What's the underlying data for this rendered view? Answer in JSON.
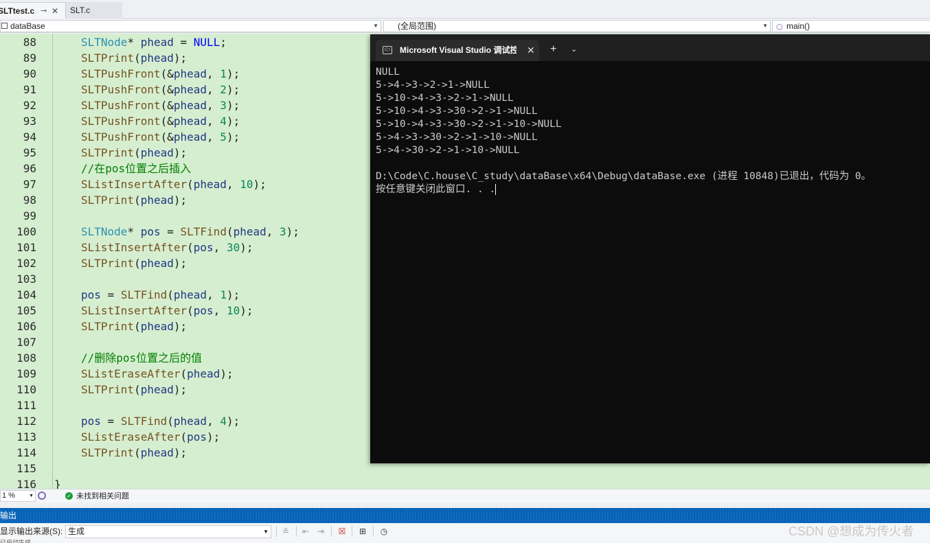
{
  "tabs": [
    {
      "label": "SLTtest.c",
      "pin": "⊸",
      "close": "✕"
    },
    {
      "label": "SLT.c"
    }
  ],
  "navbar": {
    "project": "dataBase",
    "scope": "(全局范围)",
    "member": "main()"
  },
  "editor": {
    "lines": [
      {
        "n": "88",
        "tokens": [
          [
            "t-type",
            "SLTNode"
          ],
          [
            "",
            "* "
          ],
          [
            "t-var",
            "phead"
          ],
          [
            "",
            " = "
          ],
          [
            "t-kw",
            "NULL"
          ],
          [
            "",
            ";"
          ]
        ]
      },
      {
        "n": "89",
        "tokens": [
          [
            "t-fn",
            "SLTPrint"
          ],
          [
            "",
            "("
          ],
          [
            "t-var",
            "phead"
          ],
          [
            "",
            ");"
          ]
        ]
      },
      {
        "n": "90",
        "tokens": [
          [
            "t-fn",
            "SLTPushFront"
          ],
          [
            "",
            "(&"
          ],
          [
            "t-var",
            "phead"
          ],
          [
            "",
            ", "
          ],
          [
            "t-num",
            "1"
          ],
          [
            "",
            ");"
          ]
        ]
      },
      {
        "n": "91",
        "tokens": [
          [
            "t-fn",
            "SLTPushFront"
          ],
          [
            "",
            "(&"
          ],
          [
            "t-var",
            "phead"
          ],
          [
            "",
            ", "
          ],
          [
            "t-num",
            "2"
          ],
          [
            "",
            ");"
          ]
        ]
      },
      {
        "n": "92",
        "tokens": [
          [
            "t-fn",
            "SLTPushFront"
          ],
          [
            "",
            "(&"
          ],
          [
            "t-var",
            "phead"
          ],
          [
            "",
            ", "
          ],
          [
            "t-num",
            "3"
          ],
          [
            "",
            ");"
          ]
        ]
      },
      {
        "n": "93",
        "tokens": [
          [
            "t-fn",
            "SLTPushFront"
          ],
          [
            "",
            "(&"
          ],
          [
            "t-var",
            "phead"
          ],
          [
            "",
            ", "
          ],
          [
            "t-num",
            "4"
          ],
          [
            "",
            ");"
          ]
        ]
      },
      {
        "n": "94",
        "tokens": [
          [
            "t-fn",
            "SLTPushFront"
          ],
          [
            "",
            "(&"
          ],
          [
            "t-var",
            "phead"
          ],
          [
            "",
            ", "
          ],
          [
            "t-num",
            "5"
          ],
          [
            "",
            ");"
          ]
        ]
      },
      {
        "n": "95",
        "tokens": [
          [
            "t-fn",
            "SLTPrint"
          ],
          [
            "",
            "("
          ],
          [
            "t-var",
            "phead"
          ],
          [
            "",
            ");"
          ]
        ]
      },
      {
        "n": "96",
        "tokens": [
          [
            "t-cm",
            "//在pos位置之后插入"
          ]
        ]
      },
      {
        "n": "97",
        "tokens": [
          [
            "t-fn",
            "SListInsertAfter"
          ],
          [
            "",
            "("
          ],
          [
            "t-var",
            "phead"
          ],
          [
            "",
            ", "
          ],
          [
            "t-num",
            "10"
          ],
          [
            "",
            ");"
          ]
        ]
      },
      {
        "n": "98",
        "tokens": [
          [
            "t-fn",
            "SLTPrint"
          ],
          [
            "",
            "("
          ],
          [
            "t-var",
            "phead"
          ],
          [
            "",
            ");"
          ]
        ]
      },
      {
        "n": "99",
        "tokens": []
      },
      {
        "n": "100",
        "tokens": [
          [
            "t-type",
            "SLTNode"
          ],
          [
            "",
            "* "
          ],
          [
            "t-var",
            "pos"
          ],
          [
            "",
            " = "
          ],
          [
            "t-fn",
            "SLTFind"
          ],
          [
            "",
            "("
          ],
          [
            "t-var",
            "phead"
          ],
          [
            "",
            ", "
          ],
          [
            "t-num",
            "3"
          ],
          [
            "",
            ");"
          ]
        ]
      },
      {
        "n": "101",
        "tokens": [
          [
            "t-fn",
            "SListInsertAfter"
          ],
          [
            "",
            "("
          ],
          [
            "t-var",
            "pos"
          ],
          [
            "",
            ", "
          ],
          [
            "t-num",
            "30"
          ],
          [
            "",
            ");"
          ]
        ]
      },
      {
        "n": "102",
        "tokens": [
          [
            "t-fn",
            "SLTPrint"
          ],
          [
            "",
            "("
          ],
          [
            "t-var",
            "phead"
          ],
          [
            "",
            ");"
          ]
        ]
      },
      {
        "n": "103",
        "tokens": []
      },
      {
        "n": "104",
        "tokens": [
          [
            "t-var",
            "pos"
          ],
          [
            "",
            " = "
          ],
          [
            "t-fn",
            "SLTFind"
          ],
          [
            "",
            "("
          ],
          [
            "t-var",
            "phead"
          ],
          [
            "",
            ", "
          ],
          [
            "t-num",
            "1"
          ],
          [
            "",
            ");"
          ]
        ]
      },
      {
        "n": "105",
        "tokens": [
          [
            "t-fn",
            "SListInsertAfter"
          ],
          [
            "",
            "("
          ],
          [
            "t-var",
            "pos"
          ],
          [
            "",
            ", "
          ],
          [
            "t-num",
            "10"
          ],
          [
            "",
            ");"
          ]
        ]
      },
      {
        "n": "106",
        "tokens": [
          [
            "t-fn",
            "SLTPrint"
          ],
          [
            "",
            "("
          ],
          [
            "t-var",
            "phead"
          ],
          [
            "",
            ");"
          ]
        ]
      },
      {
        "n": "107",
        "tokens": []
      },
      {
        "n": "108",
        "tokens": [
          [
            "t-cm",
            "//删除pos位置之后的值"
          ]
        ]
      },
      {
        "n": "109",
        "tokens": [
          [
            "t-fn",
            "SListEraseAfter"
          ],
          [
            "",
            "("
          ],
          [
            "t-var",
            "phead"
          ],
          [
            "",
            ");"
          ]
        ]
      },
      {
        "n": "110",
        "tokens": [
          [
            "t-fn",
            "SLTPrint"
          ],
          [
            "",
            "("
          ],
          [
            "t-var",
            "phead"
          ],
          [
            "",
            ");"
          ]
        ]
      },
      {
        "n": "111",
        "tokens": []
      },
      {
        "n": "112",
        "tokens": [
          [
            "t-var",
            "pos"
          ],
          [
            "",
            " = "
          ],
          [
            "t-fn",
            "SLTFind"
          ],
          [
            "",
            "("
          ],
          [
            "t-var",
            "phead"
          ],
          [
            "",
            ", "
          ],
          [
            "t-num",
            "4"
          ],
          [
            "",
            ");"
          ]
        ]
      },
      {
        "n": "113",
        "tokens": [
          [
            "t-fn",
            "SListEraseAfter"
          ],
          [
            "",
            "("
          ],
          [
            "t-var",
            "pos"
          ],
          [
            "",
            ");"
          ]
        ]
      },
      {
        "n": "114",
        "tokens": [
          [
            "t-fn",
            "SLTPrint"
          ],
          [
            "",
            "("
          ],
          [
            "t-var",
            "phead"
          ],
          [
            "",
            ");"
          ]
        ]
      },
      {
        "n": "115",
        "tokens": []
      },
      {
        "n": "116",
        "brace": "}",
        "tokens": []
      }
    ]
  },
  "console": {
    "title": "Microsoft Visual Studio 调试控制台",
    "close": "✕",
    "new_tab": "+",
    "dropdown": "⌄",
    "icon_text": "C:\\",
    "output": "NULL\n5->4->3->2->1->NULL\n5->10->4->3->2->1->NULL\n5->10->4->3->30->2->1->NULL\n5->10->4->3->30->2->1->10->NULL\n5->4->3->30->2->1->10->NULL\n5->4->30->2->1->10->NULL\n\nD:\\Code\\C.house\\C_study\\dataBase\\x64\\Debug\\dataBase.exe (进程 10848)已退出，代码为 0。\n按任意键关闭此窗口. . ."
  },
  "status": {
    "zoom": "1 %",
    "issues": "未找到相关问题"
  },
  "output_panel": {
    "title": "输出",
    "source_label": "显示输出来源(S):",
    "source_value": "生成",
    "fragment": "已启动生成..."
  },
  "watermark": "CSDN @想成为传火者",
  "colors": {
    "editor_bg": "#d6eed0",
    "console_bg": "#0c0c0c",
    "accent": "#0b6cc4"
  }
}
